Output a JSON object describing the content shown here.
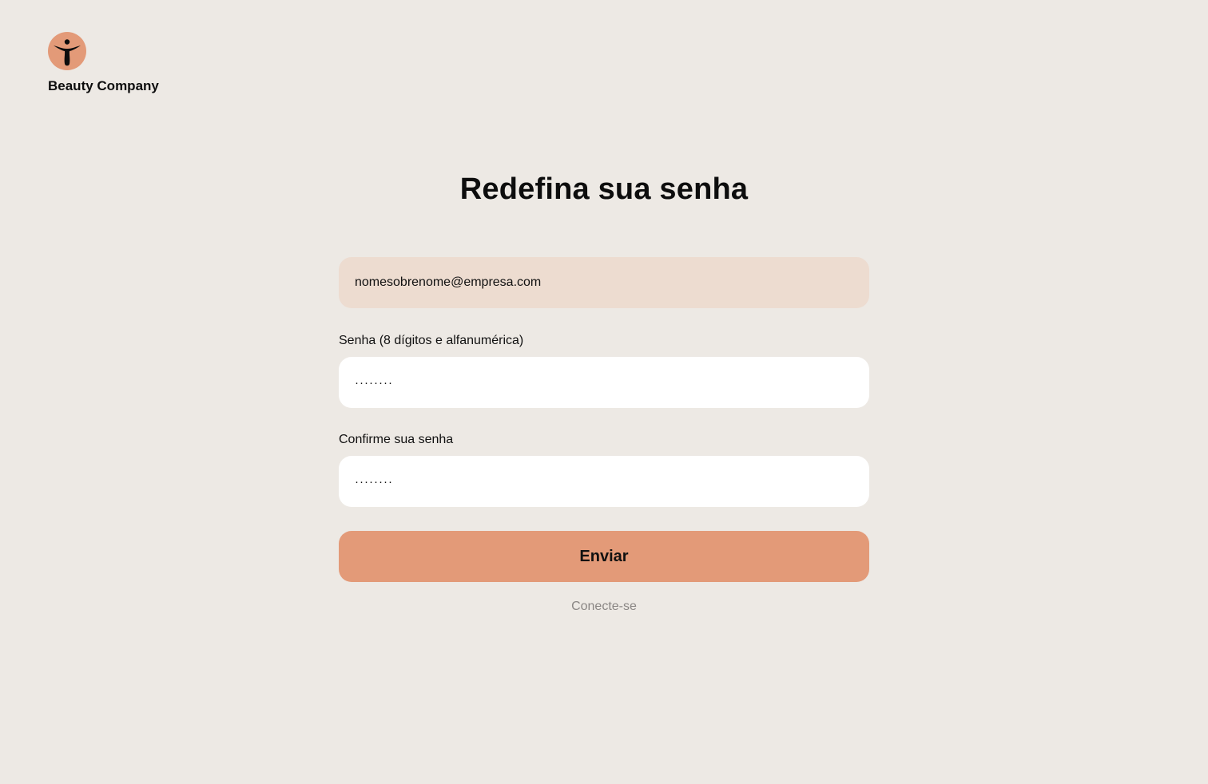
{
  "brand": {
    "name": "Beauty Company",
    "logo_icon": "person-figure-icon",
    "logo_color": "#e39a78"
  },
  "page": {
    "title": "Redefina sua senha"
  },
  "form": {
    "email_value": "nomesobrenome@empresa.com",
    "password_label": "Senha (8 dígitos e alfanumérica)",
    "password_value": "········",
    "confirm_label": "Confirme sua senha",
    "confirm_value": "········",
    "submit_label": "Enviar",
    "login_link": "Conecte-se"
  },
  "colors": {
    "background": "#ede9e4",
    "accent": "#e39a78",
    "email_field_bg": "#eddcd0",
    "input_bg": "#ffffff",
    "link_muted": "#8a8684"
  }
}
